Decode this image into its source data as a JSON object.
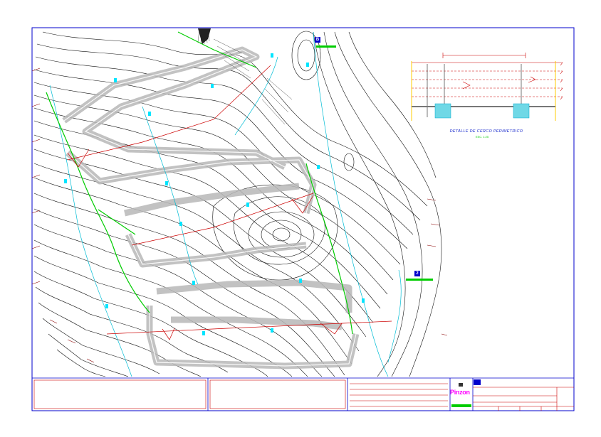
{
  "drawing": {
    "detail_title": "DETALLE DE CERCO PERIMETRICO",
    "detail_scale": "ESC. 1:25",
    "logo_text": "Pinzon",
    "marker_a": "B",
    "marker_b": "2"
  },
  "colors": {
    "frame": "#0000cc",
    "contour": "#111111",
    "terrace": "#b0b0b0",
    "road": "#00cc00",
    "water": "#00cccc",
    "section": "#cc0000",
    "boundary": "#8b0000",
    "titleblock": "#cc0000",
    "accent": "#ff00ff"
  }
}
